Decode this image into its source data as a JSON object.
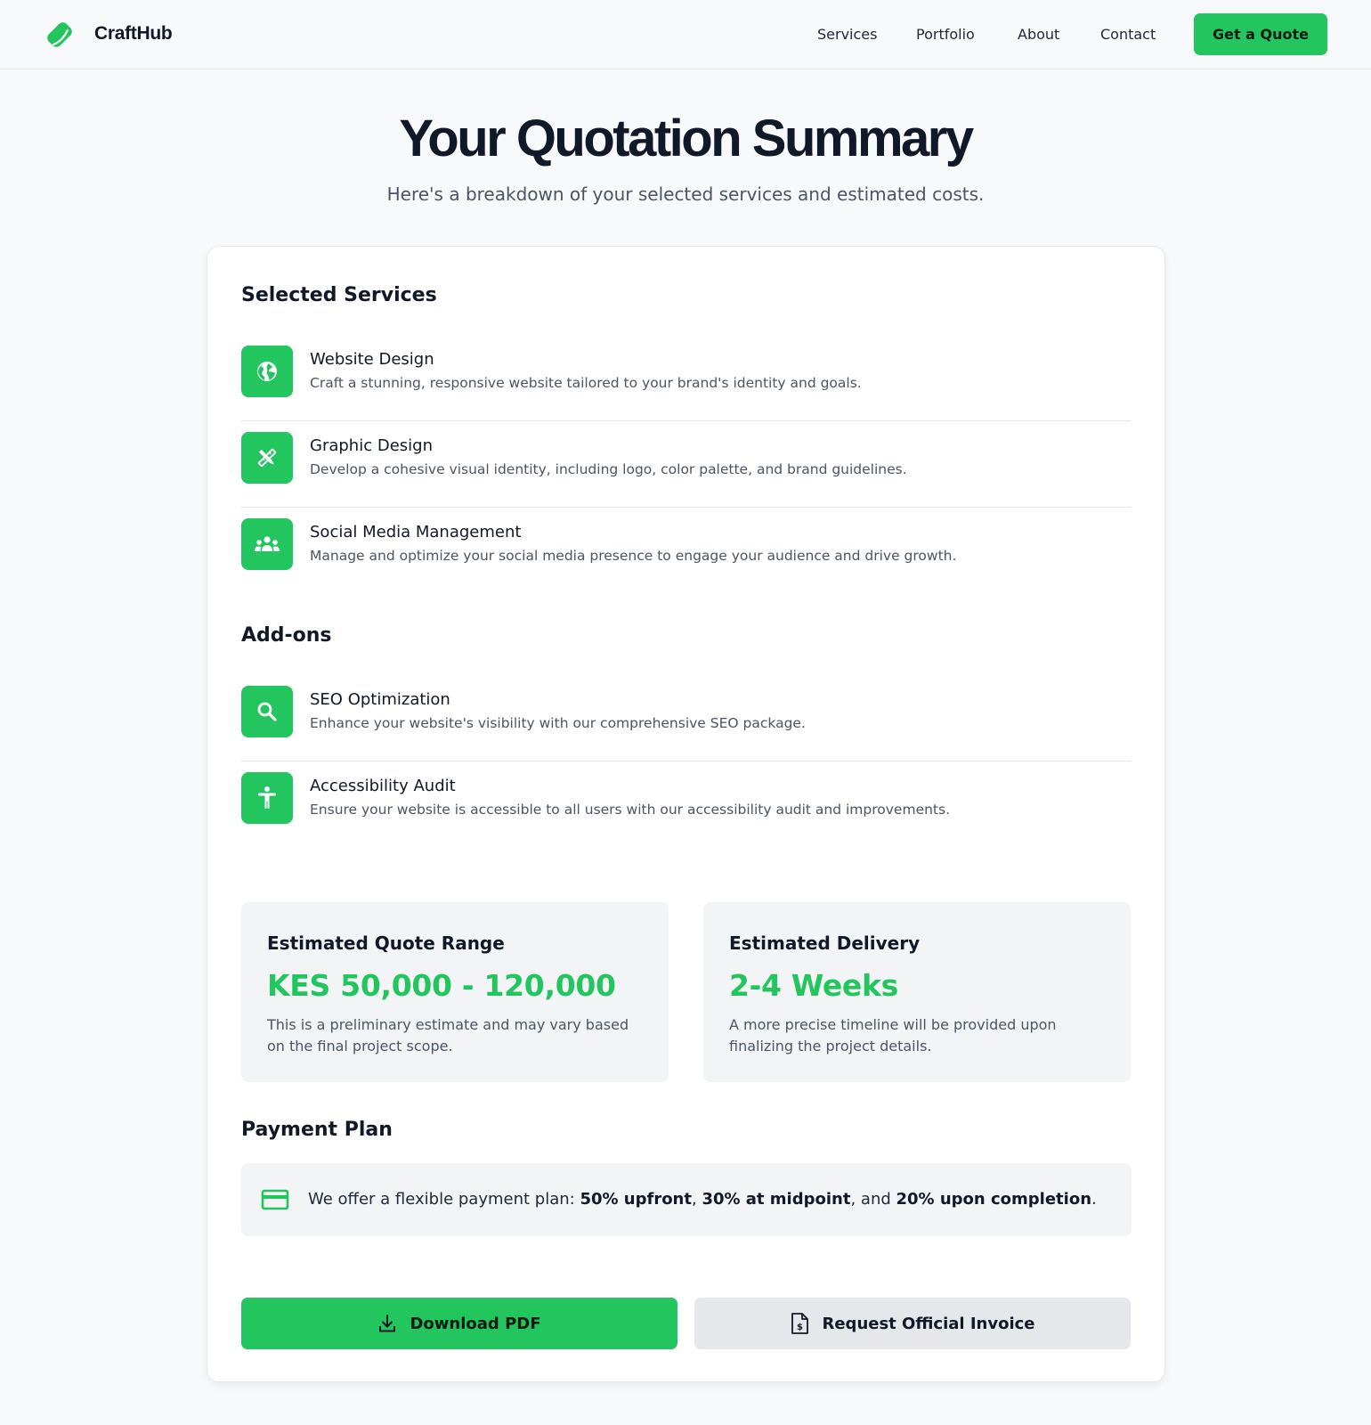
{
  "header": {
    "brand": "CraftHub",
    "nav": {
      "services": "Services",
      "portfolio": "Portfolio",
      "about": "About",
      "contact": "Contact"
    },
    "cta": "Get a Quote"
  },
  "hero": {
    "title": "Your Quotation Summary",
    "subtitle": "Here's a breakdown of your selected services and estimated costs."
  },
  "services": {
    "heading": "Selected Services",
    "items": [
      {
        "icon": "globe-icon",
        "title": "Website Design",
        "desc": "Craft a stunning, responsive website tailored to your brand's identity and goals."
      },
      {
        "icon": "design-tools-icon",
        "title": "Graphic Design",
        "desc": "Develop a cohesive visual identity, including logo, color palette, and brand guidelines."
      },
      {
        "icon": "group-icon",
        "title": "Social Media Management",
        "desc": "Manage and optimize your social media presence to engage your audience and drive growth."
      }
    ]
  },
  "addons": {
    "heading": "Add-ons",
    "items": [
      {
        "icon": "search-icon",
        "title": "SEO Optimization",
        "desc": "Enhance your website's visibility with our comprehensive SEO package."
      },
      {
        "icon": "accessibility-icon",
        "title": "Accessibility Audit",
        "desc": "Ensure your website is accessible to all users with our accessibility audit and improvements."
      }
    ]
  },
  "quote": {
    "label": "Estimated Quote Range",
    "value": "KES 50,000 - 120,000",
    "note": "This is a preliminary estimate and may vary based on the final project scope."
  },
  "delivery": {
    "label": "Estimated Delivery",
    "value": "2-4 Weeks",
    "note": "A more precise timeline will be provided upon finalizing the project details."
  },
  "payment": {
    "heading": "Payment Plan",
    "intro": "We offer a flexible payment plan: ",
    "upfront": "50% upfront",
    "sep1": ", ",
    "midpoint": "30% at midpoint",
    "sep2": ", and ",
    "completion": "20% upon completion",
    "end": "."
  },
  "actions": {
    "download": "Download PDF",
    "invoice": "Request Official Invoice"
  },
  "colors": {
    "accent": "#22c55e",
    "background": "#f8f9fb",
    "panel": "#f3f4f6",
    "text": "#111827",
    "muted": "#4b5563"
  }
}
